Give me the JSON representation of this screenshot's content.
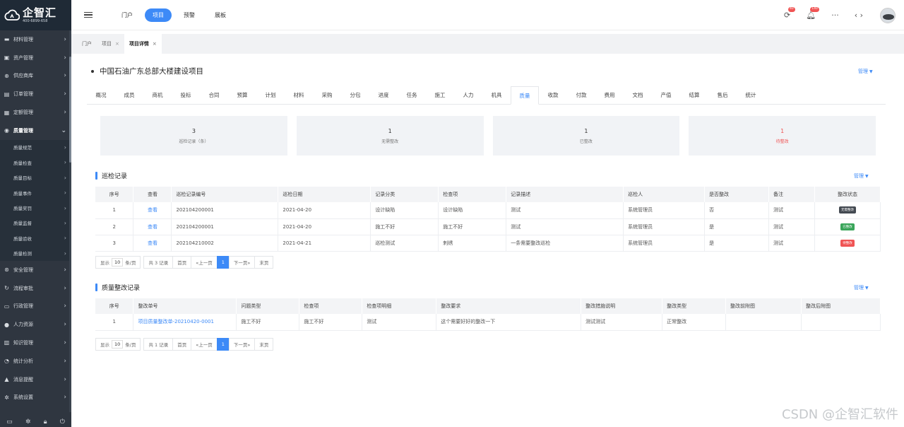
{
  "brand": {
    "name": "企智汇",
    "phone": "400-6899-658"
  },
  "sidebar": {
    "items": [
      {
        "label": "材料管理",
        "icon": "folder-icon"
      },
      {
        "label": "资产管理",
        "icon": "printer-icon"
      },
      {
        "label": "供应商库",
        "icon": "globe-icon"
      },
      {
        "label": "订单管理",
        "icon": "order-icon"
      },
      {
        "label": "定额管理",
        "icon": "grid-icon"
      },
      {
        "label": "质量管理",
        "icon": "quality-icon",
        "expanded": true
      }
    ],
    "sub_items": [
      "质量规范",
      "质量检查",
      "质量目标",
      "质量事件",
      "质量奖罚",
      "质量监督",
      "质量验收",
      "质量检测"
    ],
    "items_after": [
      {
        "label": "安全管理",
        "icon": "safety-icon"
      },
      {
        "label": "流程审批",
        "icon": "workflow-icon"
      },
      {
        "label": "行政管理",
        "icon": "briefcase-icon"
      },
      {
        "label": "人力资源",
        "icon": "user-icon"
      },
      {
        "label": "知识管理",
        "icon": "book-icon"
      },
      {
        "label": "统计分析",
        "icon": "pie-chart-icon"
      },
      {
        "label": "消息提醒",
        "icon": "bell-icon"
      },
      {
        "label": "系统设置",
        "icon": "gear-icon"
      }
    ]
  },
  "topnav": {
    "items": [
      "门户",
      "项目",
      "预警",
      "展板"
    ],
    "active": "项目"
  },
  "header_icons": {
    "refresh_badge": "40",
    "bell_badge": "140"
  },
  "tabs": [
    {
      "label": "门户",
      "closable": false
    },
    {
      "label": "项目",
      "closable": true
    },
    {
      "label": "项目详情",
      "closable": true,
      "active": true
    }
  ],
  "project": {
    "title": "中国石油广东总部大楼建设项目",
    "manage_label": "管理"
  },
  "subtabs": [
    "概况",
    "成员",
    "商机",
    "投标",
    "合同",
    "预算",
    "计划",
    "材料",
    "采购",
    "分包",
    "进度",
    "任务",
    "施工",
    "人力",
    "机具",
    "质量",
    "收款",
    "付款",
    "费用",
    "文档",
    "产值",
    "结算",
    "售后",
    "统计"
  ],
  "active_subtab": "质量",
  "stats": [
    {
      "value": "3",
      "label": "巡检记录（条）"
    },
    {
      "value": "1",
      "label": "无需整改"
    },
    {
      "value": "1",
      "label": "已整改"
    },
    {
      "value": "1",
      "label": "待整改",
      "color": "#f05454"
    }
  ],
  "inspection": {
    "title": "巡检记录",
    "manage_label": "管理",
    "columns": [
      "序号",
      "查看",
      "巡检记录编号",
      "巡检日期",
      "记录分类",
      "检查项",
      "记录描述",
      "巡检人",
      "是否整改",
      "备注",
      "整改状态"
    ],
    "rows": [
      {
        "no": "1",
        "view": "查看",
        "code": "202104200001",
        "date": "2021-04-20",
        "category": "设计缺陷",
        "item": "设计缺陷",
        "desc": "测试",
        "inspector": "系统管理员",
        "rectify": "否",
        "remark": "测试",
        "status": "无需整改",
        "status_color": "#444a52"
      },
      {
        "no": "2",
        "view": "查看",
        "code": "202104200001",
        "date": "2021-04-20",
        "category": "施工不好",
        "item": "施工不好",
        "desc": "测试",
        "inspector": "系统管理员",
        "rectify": "是",
        "remark": "测试",
        "status": "已整改",
        "status_color": "#3aa55a"
      },
      {
        "no": "3",
        "view": "查看",
        "code": "202104210002",
        "date": "2021-04-21",
        "category": "巡检测试",
        "item": "刺绣",
        "desc": "一条需要整改巡检",
        "inspector": "系统管理员",
        "rectify": "是",
        "remark": "测试",
        "status": "待整改",
        "status_color": "#f05454"
      }
    ],
    "pager": {
      "show": "显示",
      "size": "10",
      "per": "条/页",
      "total": "共 3 记录",
      "first": "首页",
      "prev": "«上一页",
      "page": "1",
      "next": "下一页»",
      "last": "末页"
    }
  },
  "rectification": {
    "title": "质量整改记录",
    "manage_label": "管理",
    "columns": [
      "序号",
      "整改单号",
      "问题类型",
      "检查项",
      "检查项明细",
      "整改要求",
      "整改措施说明",
      "整改类型",
      "整改前附图",
      "整改后附图"
    ],
    "rows": [
      {
        "no": "1",
        "code": "项目质量整改单-20210420-0001",
        "type": "施工不好",
        "item": "施工不好",
        "detail": "测试",
        "requirement": "这个需要好好的整改一下",
        "measure": "测试测试",
        "rectify_type": "正常整改",
        "before": "",
        "after": ""
      }
    ],
    "pager": {
      "show": "显示",
      "size": "10",
      "per": "条/页",
      "total": "共 1 记录",
      "first": "首页",
      "prev": "«上一页",
      "page": "1",
      "next": "下一页»",
      "last": "末页"
    }
  },
  "watermark": "CSDN @企智汇软件",
  "accent": "#3d8af7"
}
